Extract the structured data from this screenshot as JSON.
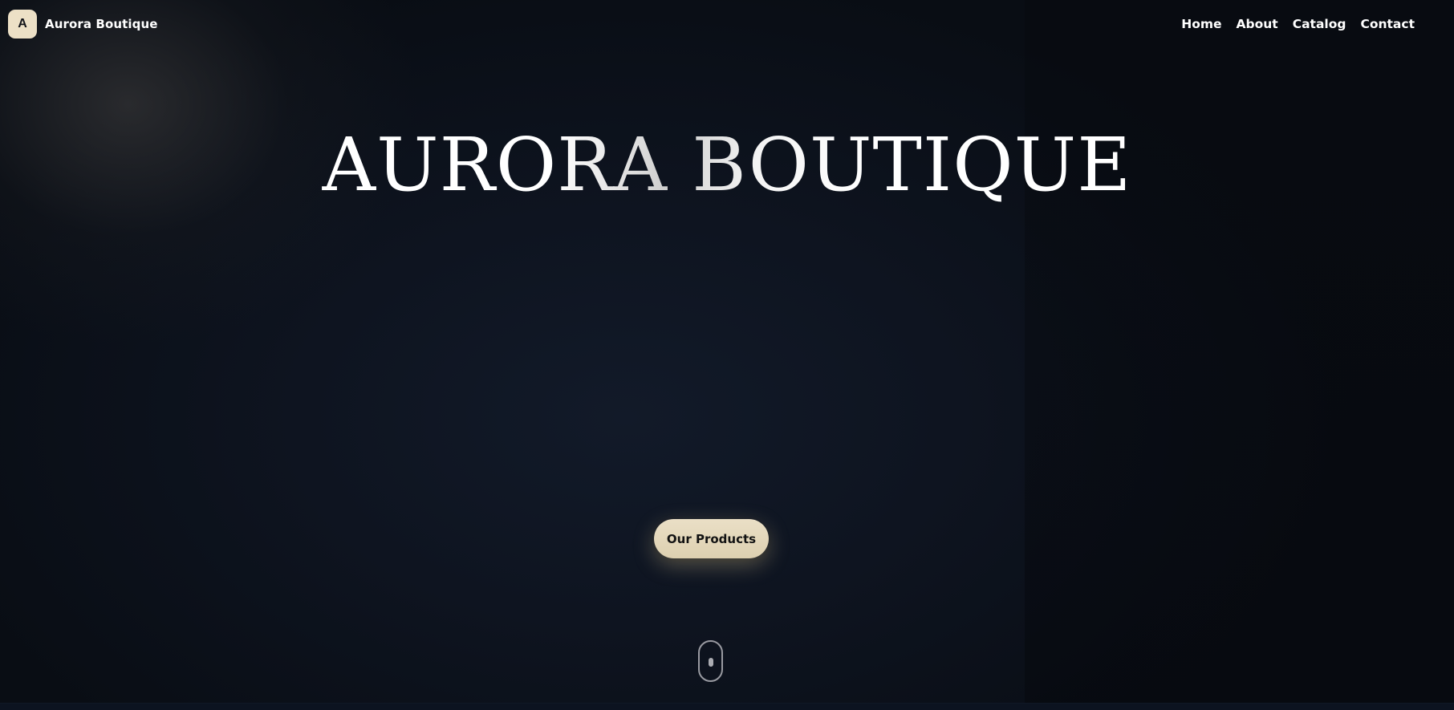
{
  "brand": {
    "logo_letter": "A",
    "name": "Aurora Boutique"
  },
  "nav": {
    "items": [
      {
        "label": "Home"
      },
      {
        "label": "About"
      },
      {
        "label": "Catalog"
      },
      {
        "label": "Contact"
      }
    ]
  },
  "hero": {
    "title": "AURORA BOUTIQUE",
    "cta_label": "Our Products"
  },
  "colors": {
    "background": "#0a0e15",
    "accent": "#ece0c6",
    "text": "#ffffff"
  },
  "icons": {
    "scroll": "mouse-scroll-icon"
  }
}
